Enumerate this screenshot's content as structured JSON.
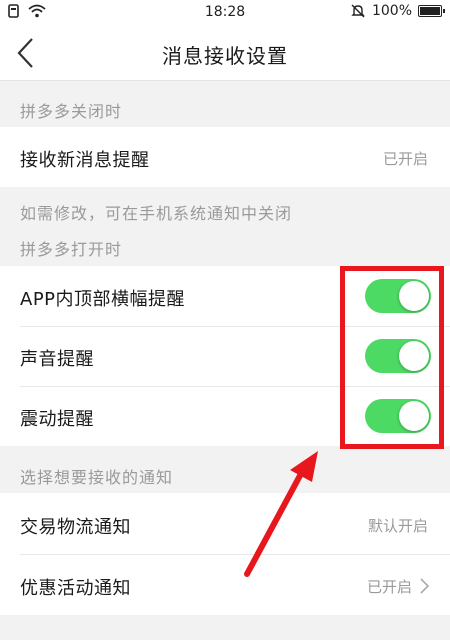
{
  "status_bar": {
    "time": "18:28",
    "battery": "100%"
  },
  "header": {
    "title": "消息接收设置"
  },
  "sections": {
    "closed": {
      "label": "拼多多关闭时",
      "new_message": {
        "label": "接收新消息提醒",
        "value": "已开启"
      },
      "hint": "如需修改，可在手机系统通知中关闭"
    },
    "open": {
      "label": "拼多多打开时",
      "banner": {
        "label": "APP内顶部横幅提醒",
        "enabled": true
      },
      "sound": {
        "label": "声音提醒",
        "enabled": true
      },
      "vibrate": {
        "label": "震动提醒",
        "enabled": true
      }
    },
    "notify": {
      "label": "选择想要接收的通知",
      "logistics": {
        "label": "交易物流通知",
        "value": "默认开启"
      },
      "promo": {
        "label": "优惠活动通知",
        "value": "已开启"
      }
    }
  },
  "colors": {
    "toggle_on": "#4cd964",
    "highlight": "#e8161d",
    "muted_text": "#9a9a9a"
  }
}
